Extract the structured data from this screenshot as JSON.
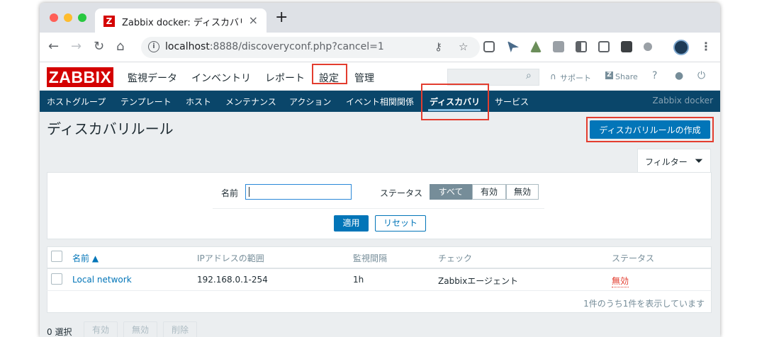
{
  "browser": {
    "tab_title": "Zabbix docker: ディスカバリル",
    "tab_favicon": "Z",
    "url_host": "localhost",
    "url_rest": ":8888/discoveryconf.php?cancel=1"
  },
  "header": {
    "logo": "ZABBIX",
    "menu": [
      "監視データ",
      "インベントリ",
      "レポート",
      "設定",
      "管理"
    ],
    "support": "サポート",
    "share": "Share",
    "help": "?"
  },
  "submenu": {
    "items": [
      "ホストグループ",
      "テンプレート",
      "ホスト",
      "メンテナンス",
      "アクション",
      "イベント相関関係",
      "ディスカバリ",
      "サービス"
    ],
    "brand": "Zabbix docker"
  },
  "page": {
    "title": "ディスカバリルール",
    "create_button": "ディスカバリルールの作成"
  },
  "filter": {
    "tab_label": "フィルター",
    "name_label": "名前",
    "name_value": "",
    "status_label": "ステータス",
    "status_options": [
      "すべて",
      "有効",
      "無効"
    ],
    "apply": "適用",
    "reset": "リセット"
  },
  "table": {
    "headers": [
      "名前 ▲",
      "IPアドレスの範囲",
      "監視間隔",
      "チェック",
      "ステータス"
    ],
    "rows": [
      {
        "name": "Local network",
        "ip_range": "192.168.0.1-254",
        "interval": "1h",
        "check": "Zabbixエージェント",
        "status": "無効"
      }
    ],
    "footer": "1件のうち1件を表示しています"
  },
  "actions": {
    "selected": "0 選択",
    "enable": "有効",
    "disable": "無効",
    "delete": "削除"
  },
  "colors": {
    "brand_red": "#d40000",
    "nav_blue": "#0a466a",
    "primary_button": "#0275b8",
    "highlight_border": "#e33d2f"
  }
}
